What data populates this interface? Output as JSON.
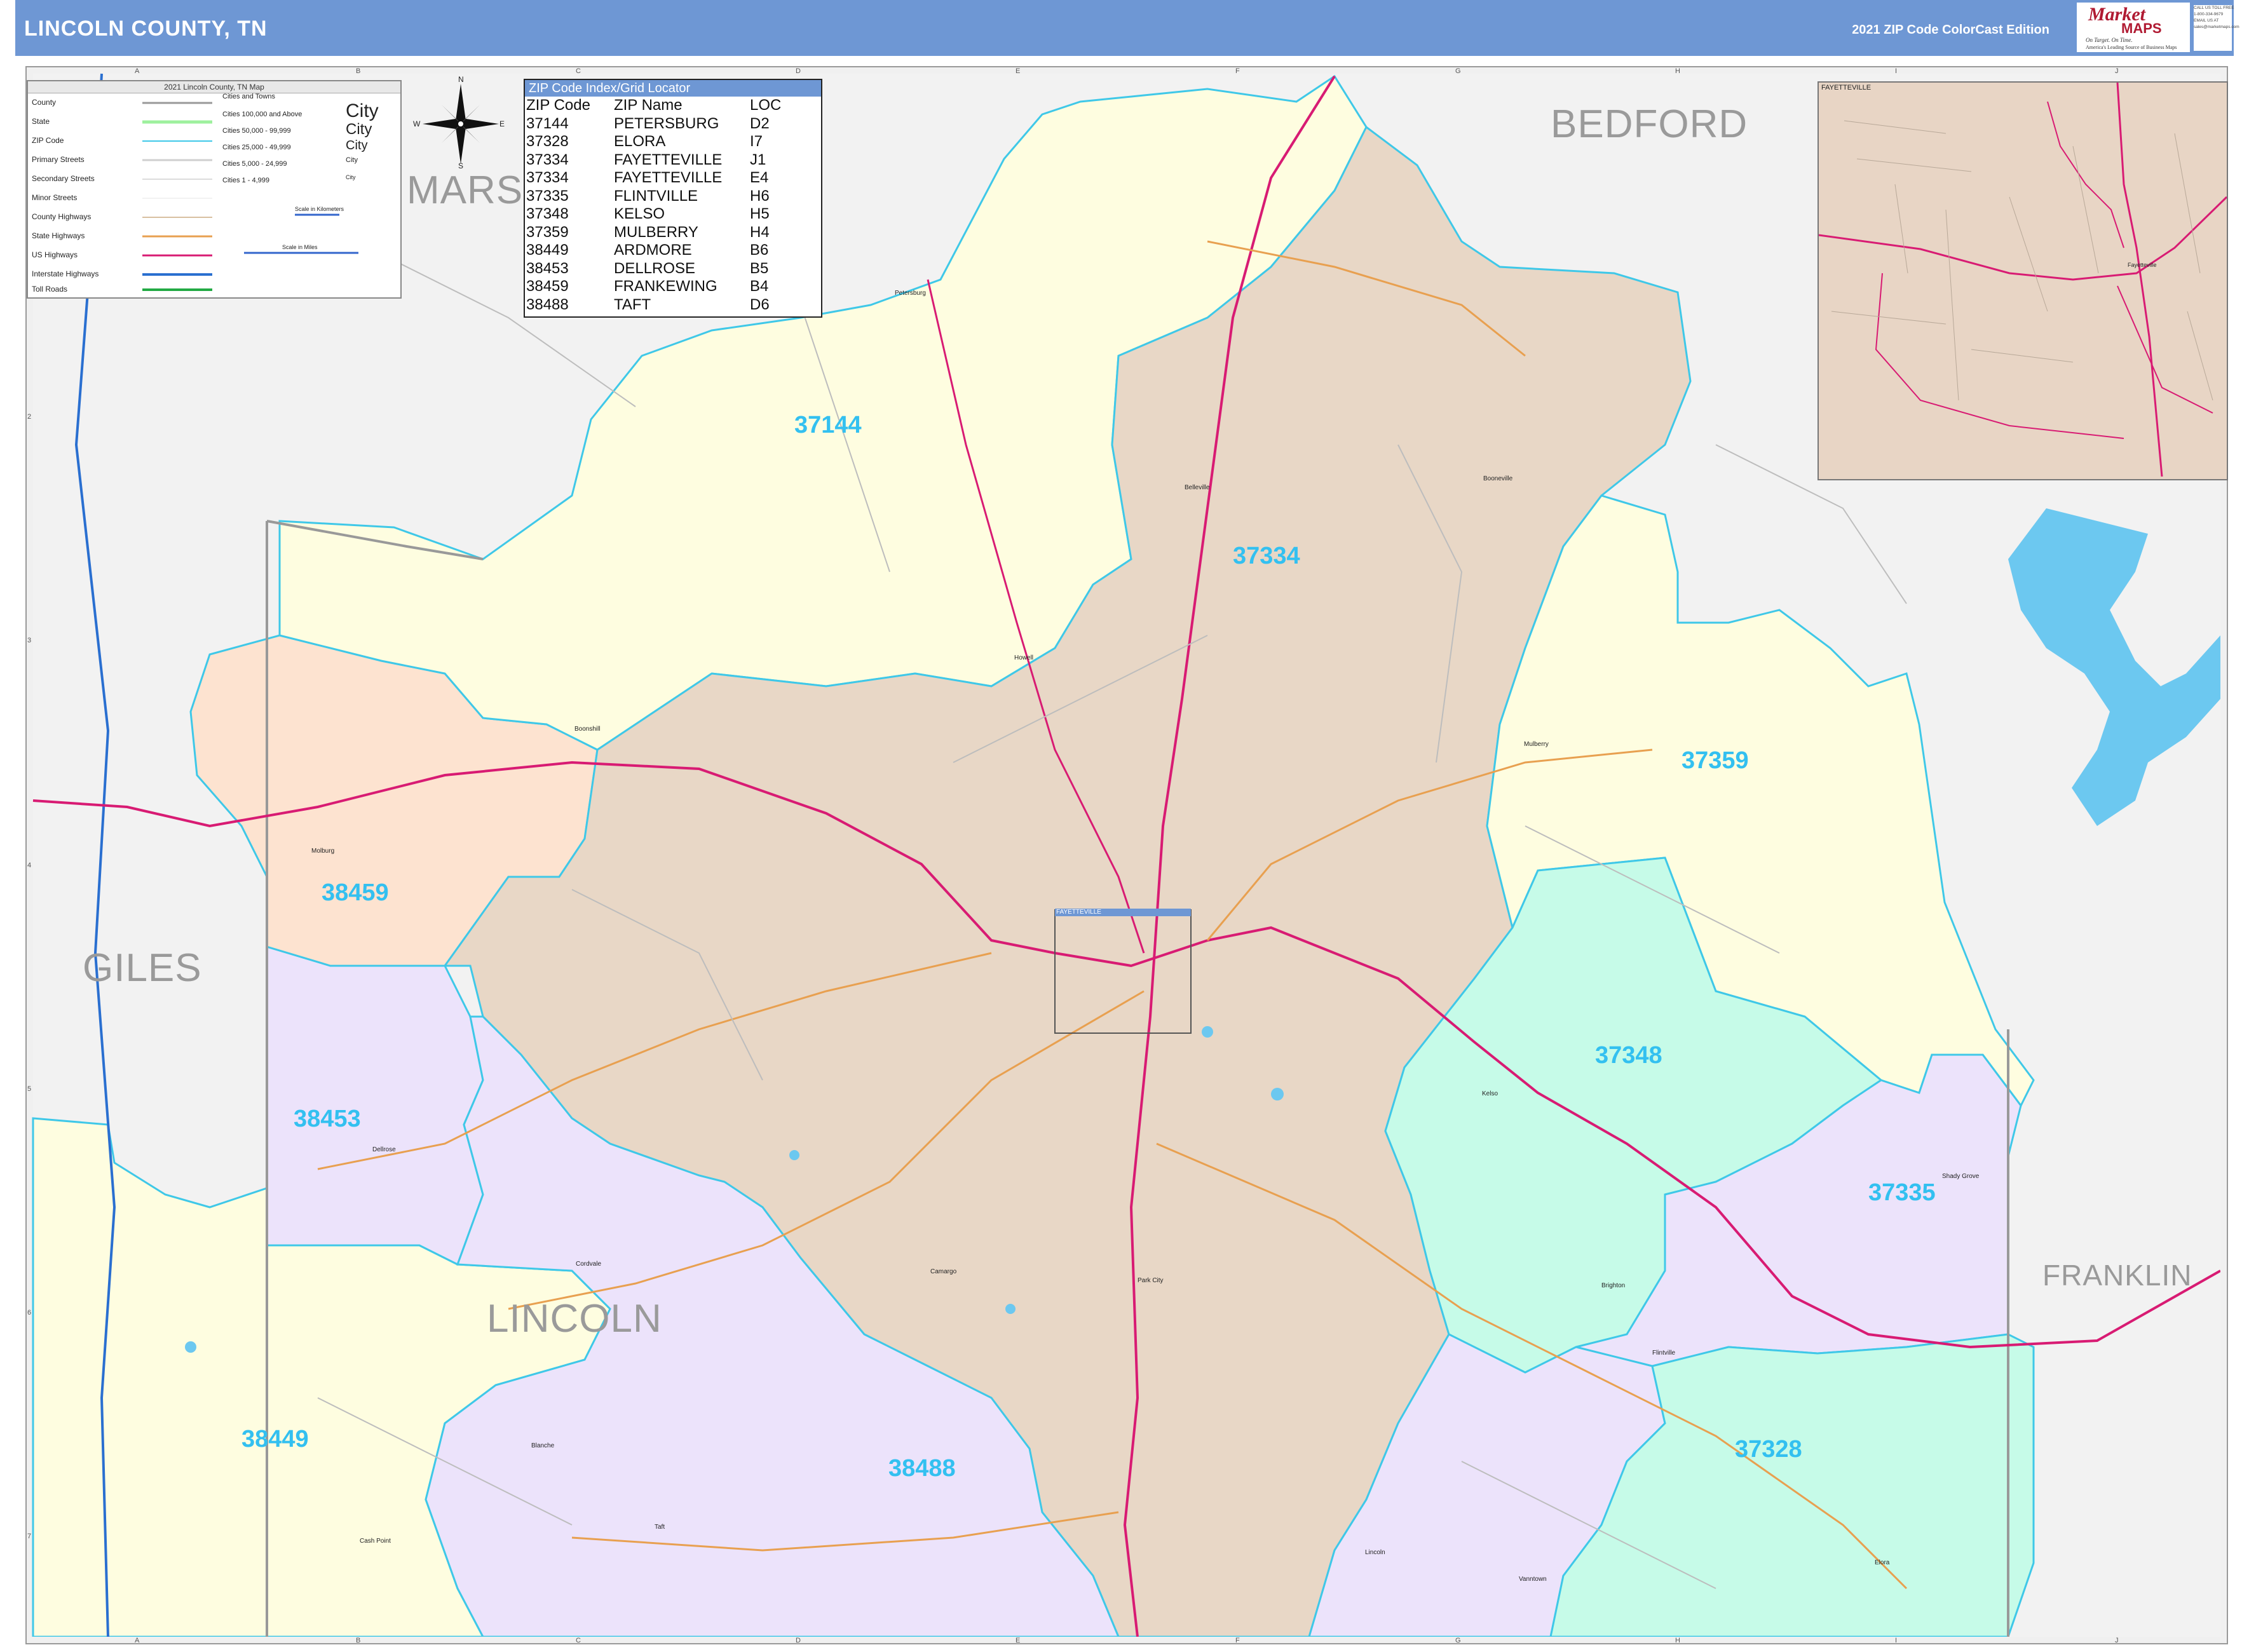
{
  "header": {
    "title": "LINCOLN COUNTY, TN",
    "edition": "2021 ZIP Code ColorCast Edition"
  },
  "brand": {
    "market": "Market",
    "maps": "MAPS",
    "tagline": "On Target. On Time.",
    "tagline2": "America's Leading Source of Business Maps",
    "contact": [
      "CALL US TOLL FREE",
      "1-800-334-9679",
      "EMAIL US AT",
      "sales@marketmaps.com"
    ]
  },
  "grid": {
    "columns": [
      "A",
      "B",
      "C",
      "D",
      "E",
      "F",
      "G",
      "H",
      "I",
      "J"
    ],
    "rows": [
      "1",
      "2",
      "3",
      "4",
      "5",
      "6",
      "7"
    ]
  },
  "legend": {
    "title": "2021 Lincoln County, TN Map",
    "rows": [
      "County",
      "State",
      "ZIP Code",
      "Primary Streets",
      "Secondary Streets",
      "Minor Streets",
      "County Highways",
      "State Highways",
      "US Highways",
      "Interstate Highways",
      "Toll Roads"
    ],
    "cities_header": "Cities and Towns",
    "cities": [
      "Cities 100,000 and Above",
      "Cities 50,000 - 99,999",
      "Cities 25,000 - 49,999",
      "Cities 5,000 - 24,999",
      "Cities 1 - 4,999"
    ],
    "city_samples": [
      "City",
      "City",
      "City",
      "City",
      "City"
    ],
    "scale_km": "Scale in Kilometers",
    "scale_mi": "Scale in Miles"
  },
  "compass": {
    "n": "N",
    "s": "S",
    "e": "E",
    "w": "W"
  },
  "zip_index": {
    "title": "ZIP Code Index/Grid Locator",
    "headers": [
      "ZIP Code",
      "ZIP Name",
      "LOC"
    ],
    "rows": [
      [
        "37144",
        "PETERSBURG",
        "D2"
      ],
      [
        "37328",
        "ELORA",
        "I7"
      ],
      [
        "37334",
        "FAYETTEVILLE",
        "J1"
      ],
      [
        "37334",
        "FAYETTEVILLE",
        "E4"
      ],
      [
        "37335",
        "FLINTVILLE",
        "H6"
      ],
      [
        "37348",
        "KELSO",
        "H5"
      ],
      [
        "37359",
        "MULBERRY",
        "H4"
      ],
      [
        "38449",
        "ARDMORE",
        "B6"
      ],
      [
        "38453",
        "DELLROSE",
        "B5"
      ],
      [
        "38459",
        "FRANKEWING",
        "B4"
      ],
      [
        "38488",
        "TAFT",
        "D6"
      ]
    ]
  },
  "counties": {
    "bedford": "BEDFORD",
    "marshall": "MARS",
    "giles": "GILES",
    "lincoln": "LINCOLN",
    "franklin": "FRANKLIN"
  },
  "zips": {
    "z37144": "37144",
    "z37334": "37334",
    "z37359": "37359",
    "z38459": "38459",
    "z37348": "37348",
    "z38453": "38453",
    "z37335": "37335",
    "z38449": "38449",
    "z38488": "38488",
    "z37328": "37328"
  },
  "places": {
    "petersburg": "Petersburg",
    "belleville": "Belleville",
    "boonesville": "Booneville",
    "howell": "Howell",
    "boonshill": "Boonshill",
    "mulberry": "Mulberry",
    "milburg": "Molburg",
    "kelso": "Kelso",
    "dellrose": "Dellrose",
    "shady_grove": "Shady Grove",
    "cordvale": "Cordvale",
    "camargo": "Camargo",
    "park_city": "Park City",
    "brighton": "Brighton",
    "flintville": "Flintville",
    "blanche": "Blanche",
    "taft": "Taft",
    "lincoln": "Lincoln",
    "vanntown": "Vanntown",
    "elora": "Elora",
    "cash_point": "Cash Point",
    "fayetteville": "Fayetteville"
  },
  "inset": {
    "label": "FAYETTEVILLE",
    "place": "Fayetteville",
    "box_label": "FAYETTEVILLE"
  },
  "colors": {
    "header": "#6e97d4",
    "z37144": "#fefde0",
    "z37334": "#e8d7c6",
    "z37359": "#fefde0",
    "z38459": "#fde3d0",
    "z37348": "#c6fbe8",
    "z38453": "#ece3fb",
    "z37335": "#ece3fb",
    "z38449": "#fefde0",
    "z38488": "#ece3fb",
    "z37328": "#c6fbe8",
    "zip_border": "#3fc8e8",
    "zip_label": "#33c0f0",
    "us_highway": "#d81b73",
    "state_highway": "#e8a050",
    "interstate": "#2a6fd0",
    "water": "#6cc8f0",
    "outside": "#f2f2f2"
  }
}
